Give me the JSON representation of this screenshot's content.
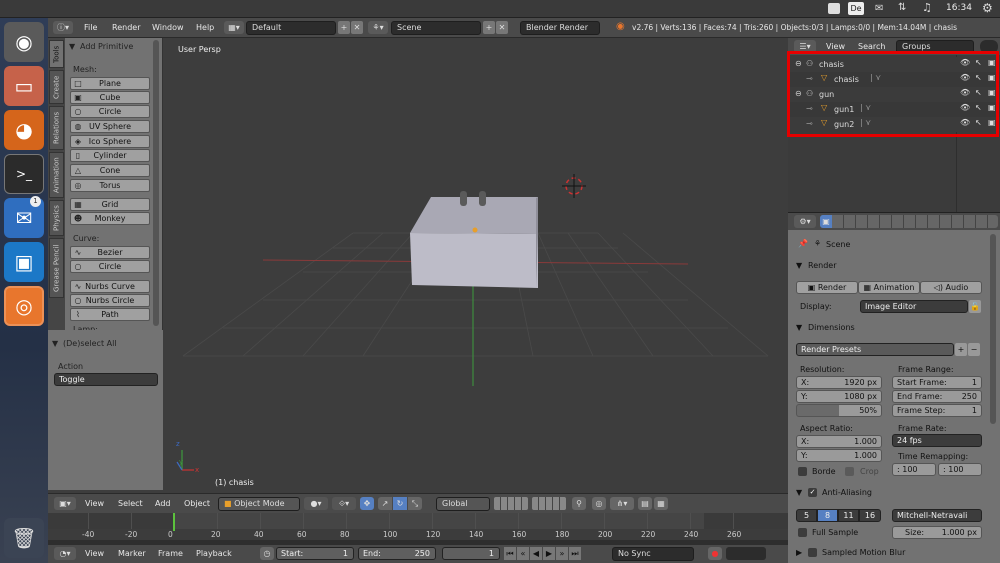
{
  "system_bar": {
    "tray": [
      "De"
    ],
    "time": "16:34"
  },
  "launcher": {
    "items": [
      "ubuntu-logo",
      "files",
      "firefox",
      "terminal",
      "thunderbird",
      "virtualbox",
      "blender",
      "trash"
    ],
    "thunderbird_badge": "1"
  },
  "header": {
    "menus": [
      "File",
      "Render",
      "Window",
      "Help"
    ],
    "screen_layout": "Default",
    "scene": "Scene",
    "engine": "Blender Render",
    "stats": "v2.76 | Verts:136 | Faces:74 | Tris:260 | Objects:0/3 | Lamps:0/0 | Mem:14.04M | chasis"
  },
  "tool_tabs": [
    "Tools",
    "Create",
    "Relations",
    "Animation",
    "Physics",
    "Grease Pencil"
  ],
  "toolshelf": {
    "panel_title": "Add Primitive",
    "mesh_label": "Mesh:",
    "mesh_items": [
      "Plane",
      "Cube",
      "Circle",
      "UV Sphere",
      "Ico Sphere",
      "Cylinder",
      "Cone",
      "Torus"
    ],
    "mesh_items2": [
      "Grid",
      "Monkey"
    ],
    "curve_label": "Curve:",
    "curve_items": [
      "Bezier",
      "Circle"
    ],
    "curve_items2": [
      "Nurbs Curve",
      "Nurbs Circle",
      "Path"
    ],
    "lamp_label": "Lamp:"
  },
  "operator_panel": {
    "title": "(De)select All",
    "action_label": "Action",
    "action_value": "Toggle"
  },
  "viewport": {
    "view_name": "User Persp",
    "object_label": "(1) chasis",
    "axis_x": "x",
    "axis_y": "y",
    "axis_z": "z"
  },
  "viewport_header": {
    "menus": [
      "View",
      "Select",
      "Add",
      "Object"
    ],
    "mode": "Object Mode",
    "orientation": "Global"
  },
  "timeline": {
    "ticks": [
      "-40",
      "-20",
      "0",
      "20",
      "40",
      "60",
      "80",
      "100",
      "120",
      "140",
      "160",
      "180",
      "200",
      "220",
      "240",
      "260"
    ],
    "current_frame_value": 0
  },
  "timeline_header": {
    "menus": [
      "View",
      "Marker",
      "Frame",
      "Playback"
    ],
    "start_label": "Start:",
    "start_value": "1",
    "end_label": "End:",
    "end_value": "250",
    "current_value": "1",
    "sync": "No Sync"
  },
  "outliner": {
    "menus": [
      "View",
      "Search"
    ],
    "display_mode": "Groups",
    "rows": [
      {
        "name": "chasis",
        "type": "group"
      },
      {
        "name": "chasis",
        "type": "object"
      },
      {
        "name": "gun",
        "type": "group"
      },
      {
        "name": "gun1",
        "type": "object"
      },
      {
        "name": "gun2",
        "type": "object"
      }
    ]
  },
  "properties": {
    "scene_label": "Scene",
    "render_section": "Render",
    "render_buttons": [
      "Render",
      "Animation",
      "Audio"
    ],
    "display_label": "Display:",
    "display_value": "Image Editor",
    "dimensions_section": "Dimensions",
    "render_presets": "Render Presets",
    "resolution_label": "Resolution:",
    "res_x_label": "X:",
    "res_x_value": "1920 px",
    "res_y_label": "Y:",
    "res_y_value": "1080 px",
    "res_percent": "50%",
    "frame_range_label": "Frame Range:",
    "start_frame_label": "Start Frame:",
    "start_frame_value": "1",
    "end_frame_label": "End Frame:",
    "end_frame_value": "250",
    "frame_step_label": "Frame Step:",
    "frame_step_value": "1",
    "aspect_label": "Aspect Ratio:",
    "aspect_x_label": "X:",
    "aspect_x_value": "1.000",
    "aspect_y_label": "Y:",
    "aspect_y_value": "1.000",
    "frame_rate_label": "Frame Rate:",
    "frame_rate_value": "24 fps",
    "time_remap_label": "Time Remapping:",
    "remap_old": "100",
    "remap_new": "100",
    "border_label": "Borde",
    "crop_label": "Crop",
    "aa_section": "Anti-Aliasing",
    "aa_samples": [
      "5",
      "8",
      "11",
      "16"
    ],
    "aa_filter": "Mitchell-Netravali",
    "full_sample_label": "Full Sample",
    "size_label": "Size:",
    "size_value": "1.000 px",
    "motion_blur_section": "Sampled Motion Blur"
  },
  "colors": {
    "highlight": "#e60000",
    "selected_blue": "#5680c2",
    "object_orange": "#e89f2a"
  }
}
